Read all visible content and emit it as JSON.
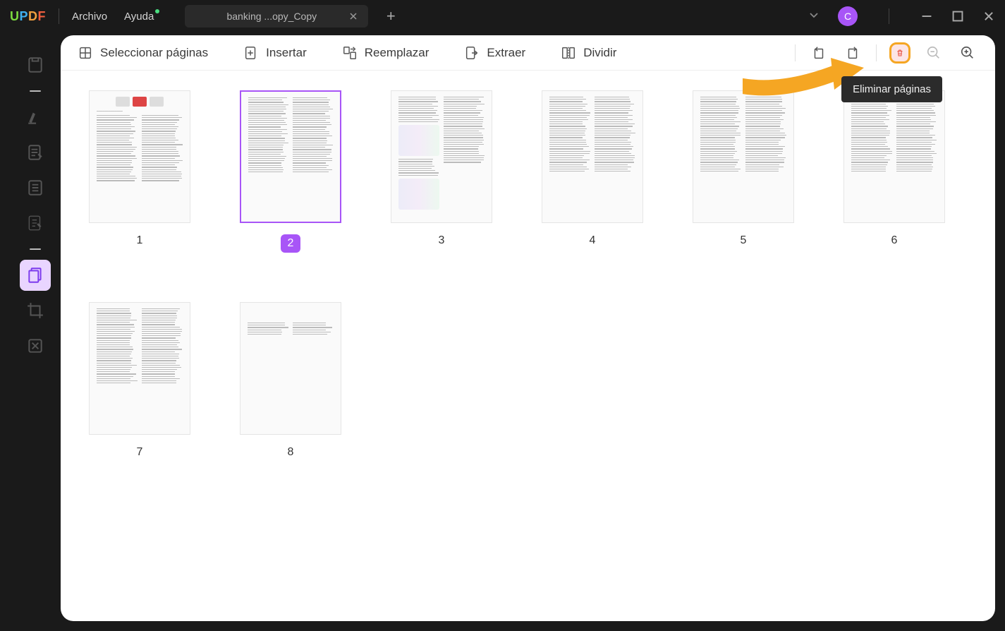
{
  "app": {
    "logo": "UPDF"
  },
  "menu": {
    "file": "Archivo",
    "help": "Ayuda"
  },
  "tab": {
    "title": "banking ...opy_Copy"
  },
  "avatar": {
    "initial": "C"
  },
  "toolbar": {
    "select": "Seleccionar páginas",
    "insert": "Insertar",
    "replace": "Reemplazar",
    "extract": "Extraer",
    "split": "Dividir"
  },
  "tooltip": {
    "delete": "Eliminar páginas"
  },
  "pages": {
    "count": 8,
    "selected": 2,
    "labels": [
      "1",
      "2",
      "3",
      "4",
      "5",
      "6",
      "7",
      "8"
    ]
  }
}
